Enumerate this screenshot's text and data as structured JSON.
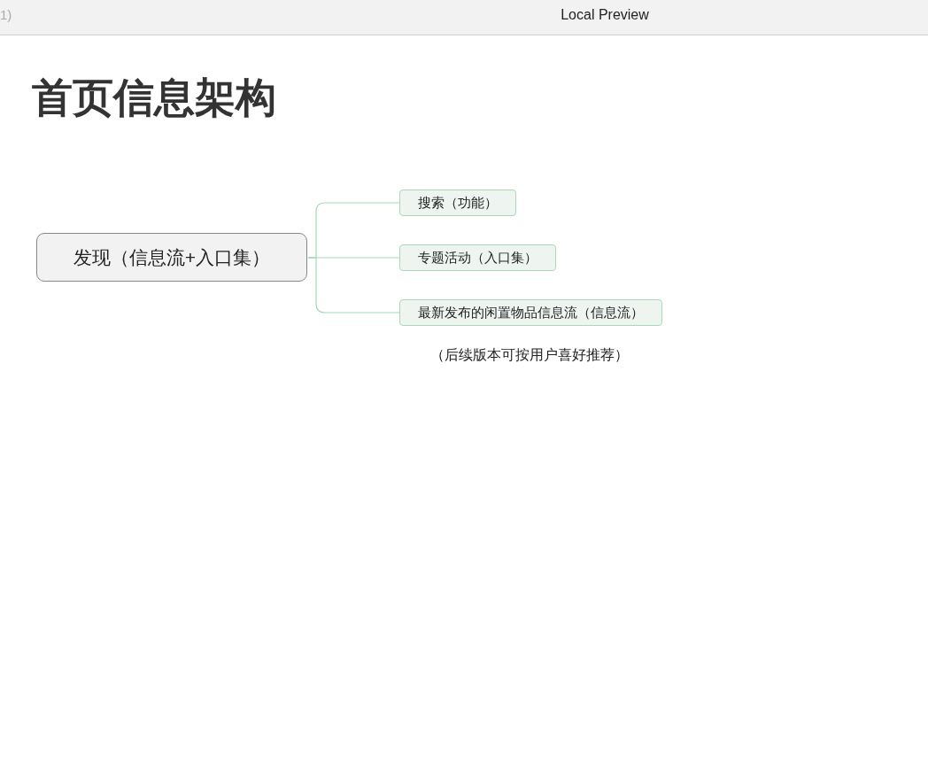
{
  "window": {
    "title_fragment": "1)",
    "title": "Local Preview"
  },
  "heading": "首页信息架构",
  "mindmap": {
    "root": "发现（信息流+入口集）",
    "children": [
      {
        "label": "搜索（功能）"
      },
      {
        "label": "专题活动（入口集）"
      },
      {
        "label": "最新发布的闲置物品信息流（信息流）"
      }
    ],
    "note": "（后续版本可按用户喜好推荐）"
  }
}
